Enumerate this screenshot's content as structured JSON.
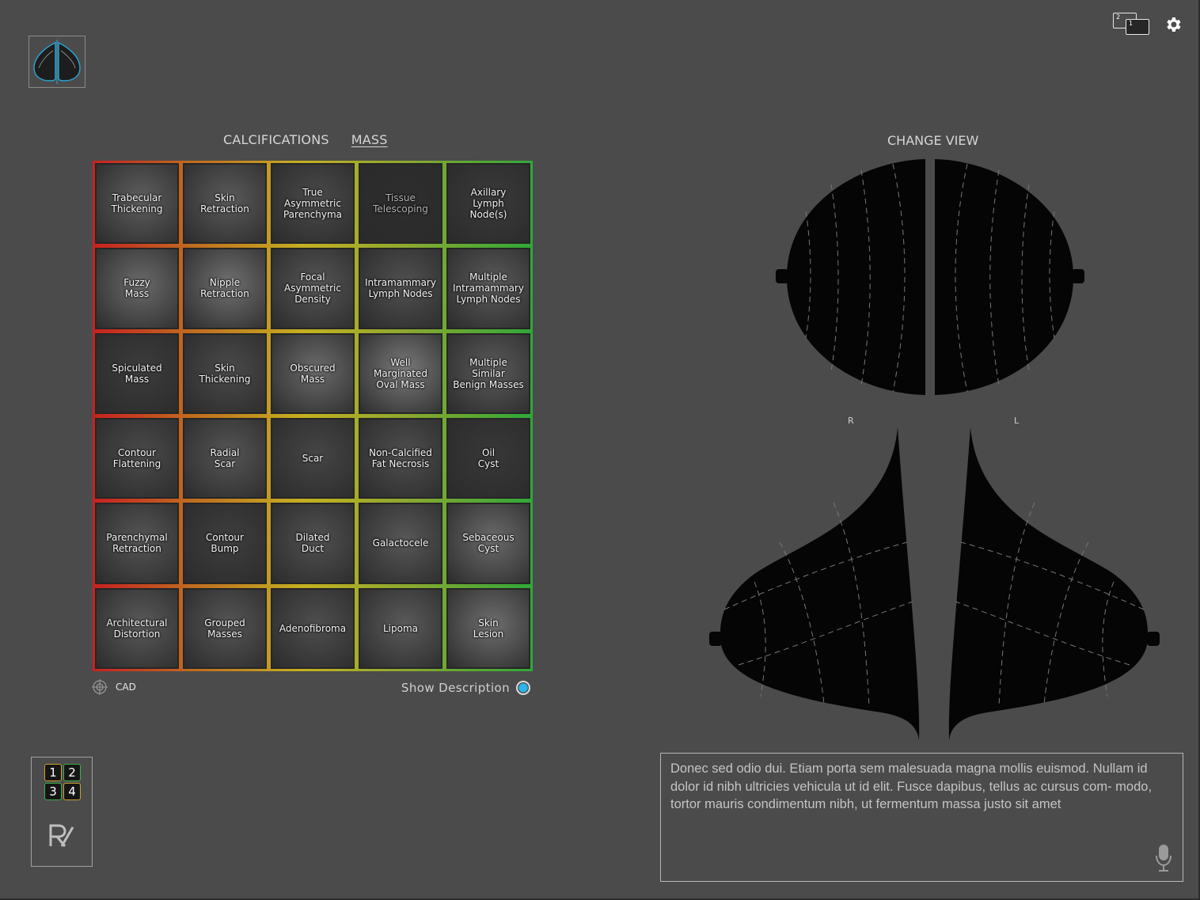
{
  "tabs": [
    {
      "label": "CALCIFICATIONS",
      "active": false
    },
    {
      "label": "MASS",
      "active": true
    }
  ],
  "grid": [
    {
      "label": "Trabecular\nThickening",
      "bg": "#5e5e5e"
    },
    {
      "label": "Skin\nRetraction",
      "bg": "#5a5a5a"
    },
    {
      "label": "True\nAsymmetric\nParenchyma",
      "bg": "#4a4a4a"
    },
    {
      "label": "Tissue\nTelescoping",
      "bg": "#2e2e2e",
      "dim": true
    },
    {
      "label": "Axillary\nLymph\nNode(s)",
      "bg": "#3a3a3a"
    },
    {
      "label": "Fuzzy\nMass",
      "bg": "#6a6a6a"
    },
    {
      "label": "Nipple\nRetraction",
      "bg": "#707070"
    },
    {
      "label": "Focal\nAsymmetric\nDensity",
      "bg": "#555555"
    },
    {
      "label": "Intramammary\nLymph Nodes",
      "bg": "#505050"
    },
    {
      "label": "Multiple\nIntramammary\nLymph Nodes",
      "bg": "#5a5a5a"
    },
    {
      "label": "Spiculated\nMass",
      "bg": "#3c3c3c"
    },
    {
      "label": "Skin\nThickening",
      "bg": "#4a4a4a"
    },
    {
      "label": "Obscured\nMass",
      "bg": "#6a6a6a"
    },
    {
      "label": "Well\nMarginated\nOval Mass",
      "bg": "#7a7a7a"
    },
    {
      "label": "Multiple\nSimilar\nBenign Masses",
      "bg": "#5a5a5a"
    },
    {
      "label": "Contour\nFlattening",
      "bg": "#4a4a4a"
    },
    {
      "label": "Radial\nScar",
      "bg": "#555555"
    },
    {
      "label": "Scar",
      "bg": "#454545"
    },
    {
      "label": "Non-Calcified\nFat Necrosis",
      "bg": "#4e4e4e"
    },
    {
      "label": "Oil\nCyst",
      "bg": "#383838"
    },
    {
      "label": "Parenchymal\nRetraction",
      "bg": "#555555"
    },
    {
      "label": "Contour\nBump",
      "bg": "#3e3e3e"
    },
    {
      "label": "Dilated\nDuct",
      "bg": "#505050"
    },
    {
      "label": "Galactocele",
      "bg": "#575757"
    },
    {
      "label": "Sebaceous\nCyst",
      "bg": "#6a6a6a"
    },
    {
      "label": "Architectural\nDistortion",
      "bg": "#5a5a5a"
    },
    {
      "label": "Grouped\nMasses",
      "bg": "#555555"
    },
    {
      "label": "Adenofibroma",
      "bg": "#4e4e4e"
    },
    {
      "label": "Lipoma",
      "bg": "#5a5a5a"
    },
    {
      "label": "Skin\nLesion",
      "bg": "#6e6e6e"
    }
  ],
  "cad_label": "CAD",
  "show_description_label": "Show Description",
  "change_view_label": "CHANGE VIEW",
  "side_labels": {
    "right": "R",
    "left": "L"
  },
  "numpad": [
    "1",
    "2",
    "3",
    "4"
  ],
  "notes_text": "Donec sed odio dui. Etiam porta sem malesuada magna mollis euismod. Nullam id dolor id nibh ultricies vehicula ut id elit. Fusce dapibus, tellus ac cursus com- modo, tortor mauris condimentum nibh, ut fermentum massa justo sit amet",
  "colors": {
    "background": "#4b4b4b",
    "accent": "#2ab4ec",
    "logo": "#2aa8d8"
  }
}
